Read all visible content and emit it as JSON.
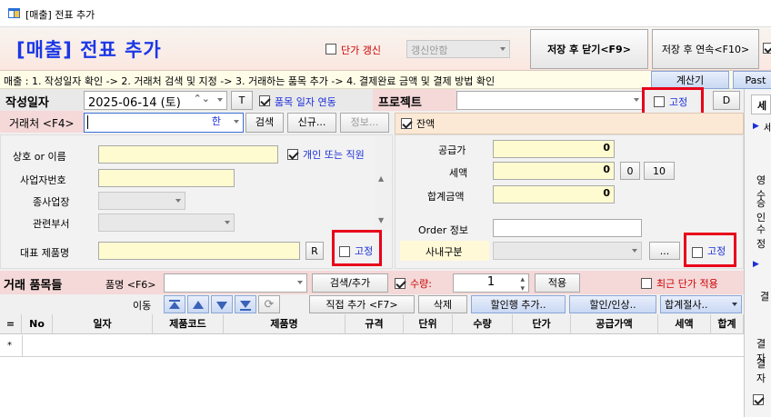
{
  "window": {
    "title": "[매출] 전표 추가"
  },
  "header": {
    "title": "[매출] 전표 추가",
    "price_update_label": "단가 갱신",
    "price_update_select": "갱신안함",
    "save_close_label": "저장 후 닫기<F9>",
    "save_continue_label": "저장 후 연속<F10>"
  },
  "steps": {
    "text": "매출 : 1. 작성일자 확인 -> 2. 거래처 검색 및 지정 -> 3. 거래하는 품목 추가 -> 4. 결제완료 금액 및 결제 방법 확인"
  },
  "top_buttons": {
    "calculator": "계산기",
    "paste": "Past"
  },
  "date_row": {
    "label": "작성일자",
    "value": "2025-06-14 (토)",
    "t_button": "T",
    "item_date_link": "품목 일자 연동"
  },
  "project": {
    "label": "프로젝트",
    "fixed_label": "고정",
    "d_button": "D"
  },
  "client": {
    "label": "거래처 <F4>",
    "ime": "한",
    "search_btn": "검색",
    "new_btn": "신규...",
    "info_btn": "정보..."
  },
  "form": {
    "name_label": "상호 or 이름",
    "personal_label": "개인 또는 직원",
    "bizno_label": "사업자번호",
    "branch_label": "종사업장",
    "dept_label": "관련부서",
    "rep_product_label": "대표 제품명",
    "r_button": "R",
    "fixed_label": "고정"
  },
  "balance": {
    "label": "잔액",
    "supply_label": "공급가",
    "supply_value": "0",
    "tax_label": "세액",
    "tax_value": "0",
    "tax_btn0": "0",
    "tax_btn10": "10",
    "total_label": "합계금액",
    "total_value": "0",
    "order_label": "Order 정보",
    "internal_label": "사내구분",
    "dots_btn": "...",
    "fixed_label": "고정"
  },
  "items": {
    "label": "거래 품목들",
    "product_label": "품명 <F6>",
    "search_add": "검색/추가",
    "qty_label": "수량:",
    "qty_value": "1",
    "apply": "적용",
    "recent_price": "최근 단가 적용",
    "move_label": "이동",
    "direct_add": "직접 추가 <F7>",
    "delete": "삭제",
    "discount_add": "할인행 추가..",
    "discount_raise": "할인/인상..",
    "round": "합계절사.."
  },
  "grid": {
    "columns": [
      "=",
      "No",
      "일자",
      "제품코드",
      "제품명",
      "규격",
      "단위",
      "수량",
      "단가",
      "공급가액",
      "세액",
      "합계"
    ],
    "new_row_marker": "*"
  },
  "right_panel": {
    "tab": "세",
    "l1": "세",
    "l2": "영수",
    "l3": "승인",
    "l4": "수정",
    "l5": "결",
    "l6": "결자",
    "l7": "결자"
  },
  "colors": {
    "title_blue": "#1a37e6",
    "red_highlight": "#e8001a",
    "label_red": "#cc0000",
    "label_blue": "#1a2fd8"
  }
}
